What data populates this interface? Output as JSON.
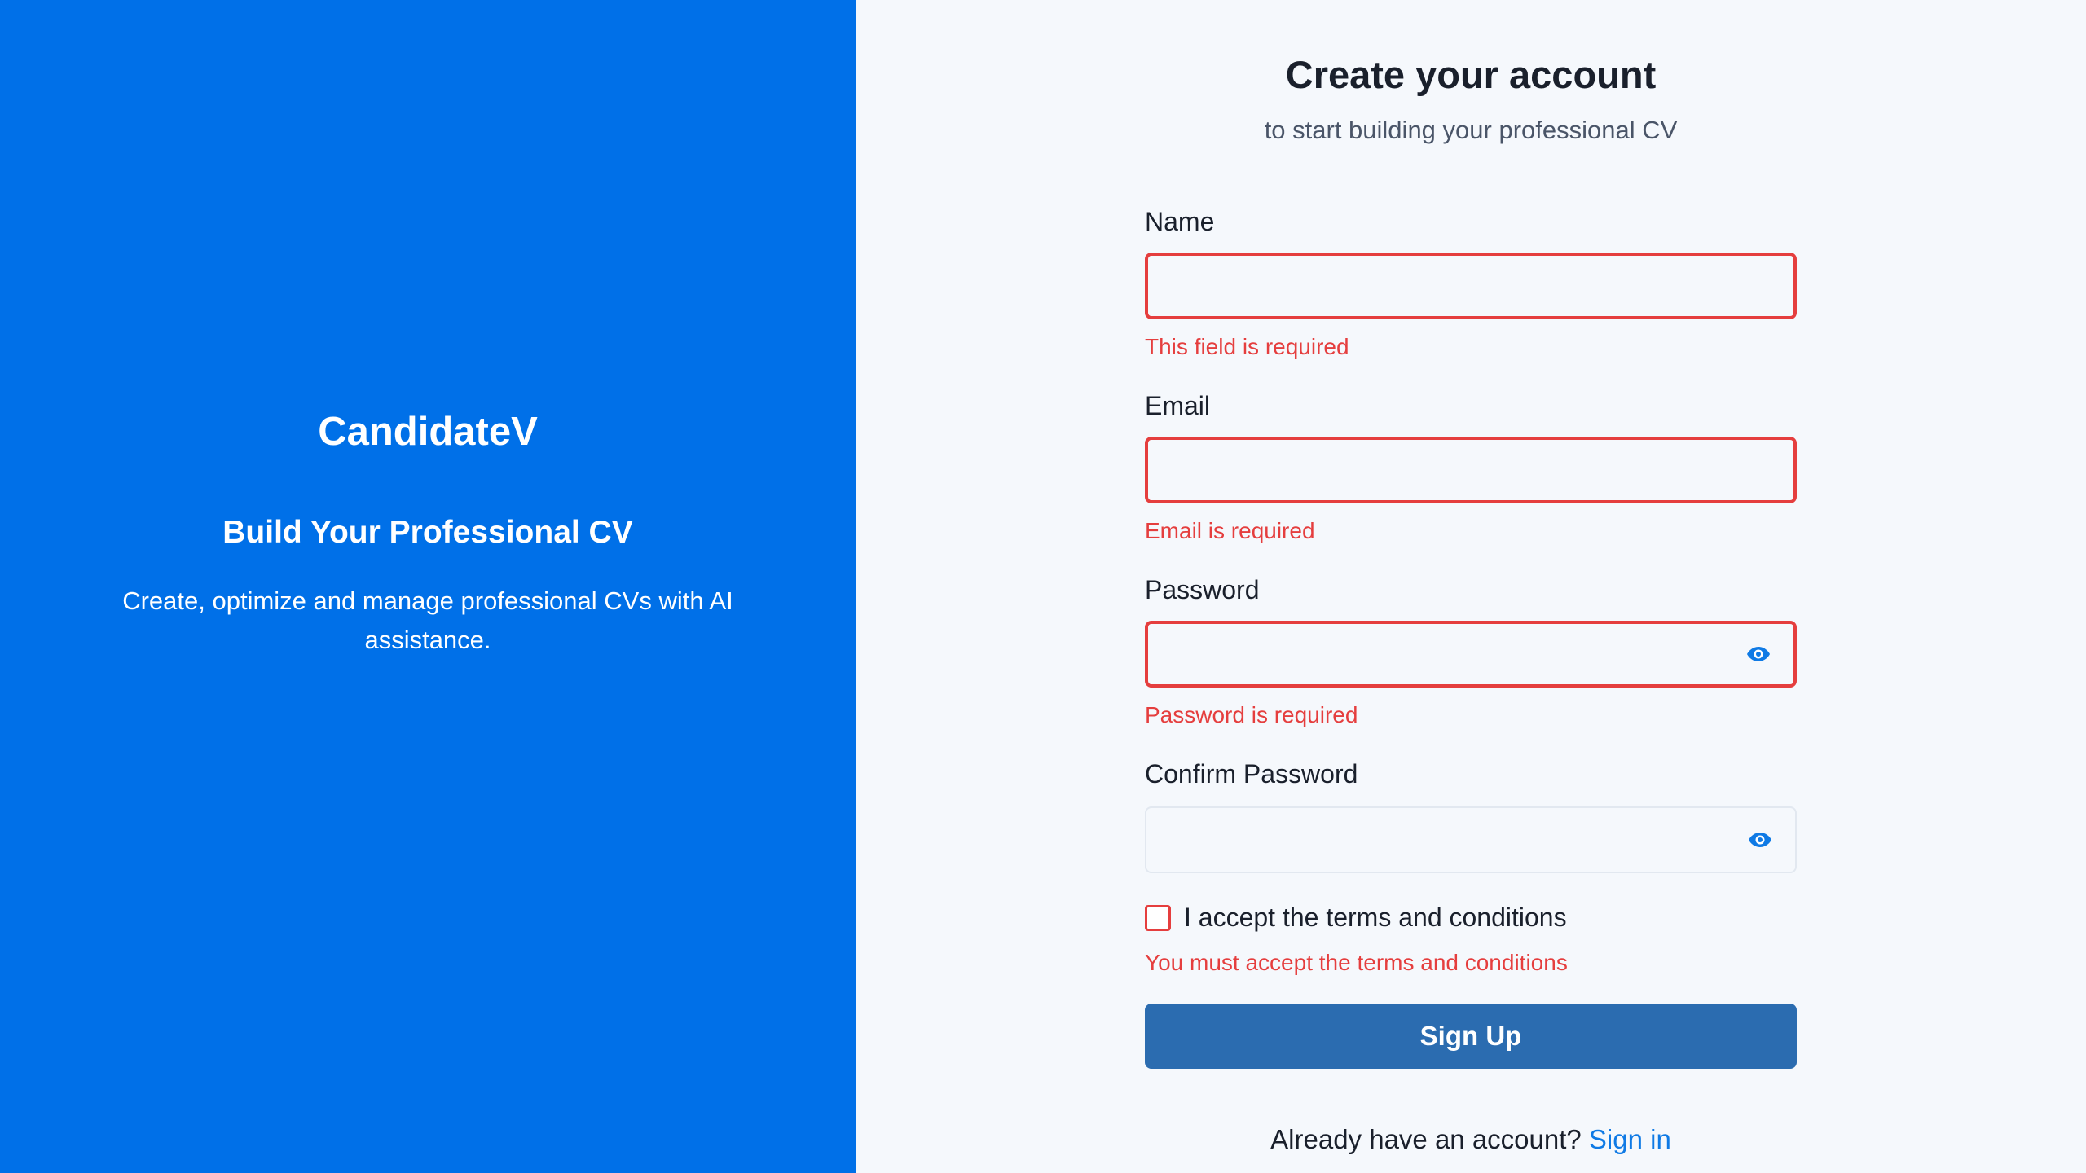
{
  "brand": {
    "name": "CandidateV",
    "tagline": "Build Your Professional CV",
    "description": "Create, optimize and manage professional CVs with AI assistance."
  },
  "form": {
    "title": "Create your account",
    "subtitle": "to start building your professional CV",
    "fields": {
      "name": {
        "label": "Name",
        "value": "",
        "error": "This field is required"
      },
      "email": {
        "label": "Email",
        "value": "",
        "error": "Email is required"
      },
      "password": {
        "label": "Password",
        "value": "",
        "error": "Password is required"
      },
      "confirm_password": {
        "label": "Confirm Password",
        "value": ""
      }
    },
    "terms": {
      "label": "I accept the terms and conditions",
      "checked": false,
      "error": "You must accept the terms and conditions"
    },
    "submit_label": "Sign Up",
    "signin_prompt": "Already have an account?",
    "signin_link": "Sign in"
  },
  "icons": {
    "password_toggle": "eye-icon",
    "confirm_password_toggle": "eye-icon"
  },
  "colors": {
    "brand_panel": "#0070e8",
    "error": "#e53e3e",
    "button": "#2b6cb0",
    "link": "#0f7ae5"
  }
}
